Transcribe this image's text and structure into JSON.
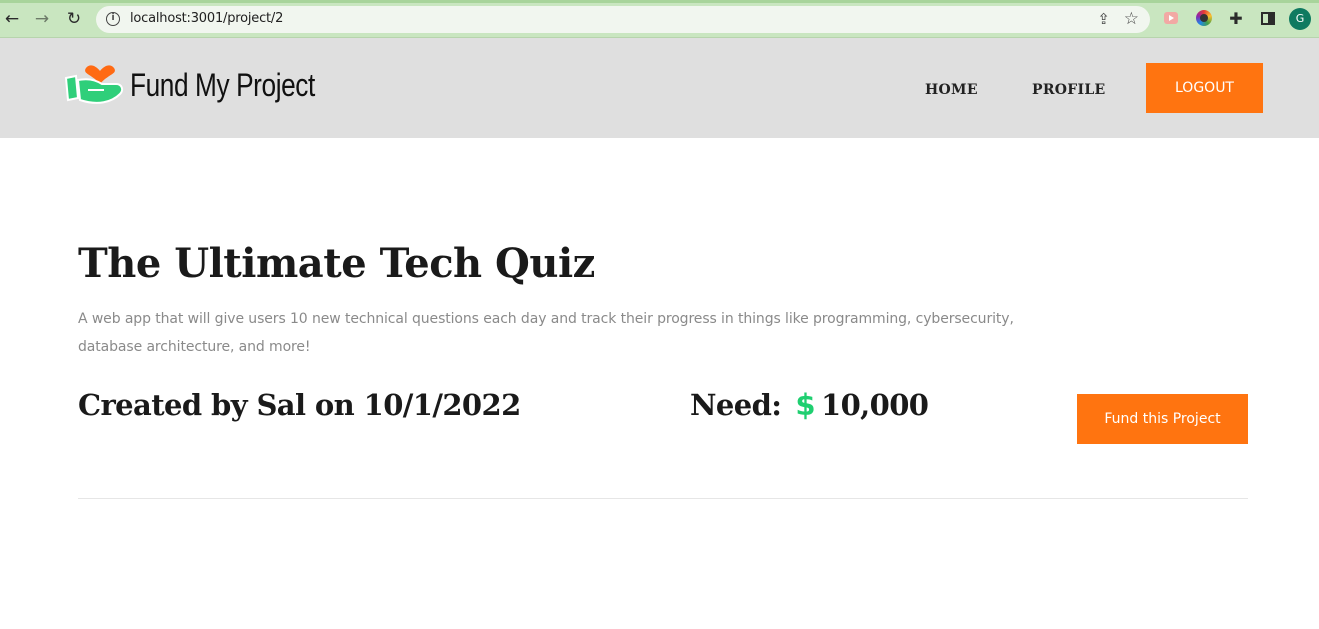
{
  "browser": {
    "url": "localhost:3001/project/2",
    "profile_initial": "G",
    "icons": [
      "back-arrow-icon",
      "forward-arrow-icon",
      "reload-icon",
      "info-icon",
      "share-icon",
      "star-icon",
      "screen-recorder-icon",
      "color-picker-icon",
      "puzzle-icon",
      "side-panel-icon"
    ]
  },
  "header": {
    "brand": "Fund My Project",
    "nav": {
      "home": "HOME",
      "profile": "PROFILE",
      "logout": "LOGOUT"
    }
  },
  "project": {
    "title": "The Ultimate Tech Quiz",
    "description": "A web app that will give users 10 new technical questions each day and track their progress in things like programming, cybersecurity, database architecture, and more!",
    "created": "Created by Sal on 10/1/2022",
    "need_label": "Need:",
    "currency_symbol": "$",
    "need_amount": "10,000",
    "fund_button": "Fund this Project"
  },
  "colors": {
    "accent": "#ff7410",
    "dollar": "#1fcf70",
    "header_bg": "#dfdfdf",
    "logo_green": "#2fcf7a",
    "logo_orange": "#ff6a13"
  }
}
